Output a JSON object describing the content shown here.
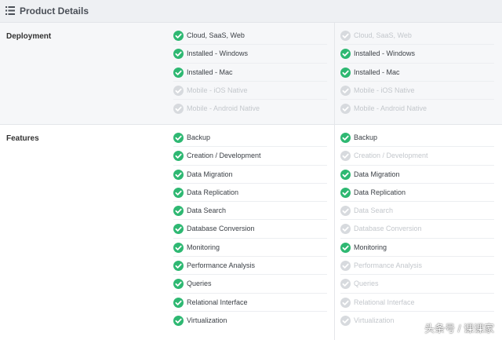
{
  "header": {
    "title": "Product Details"
  },
  "colors": {
    "check_on": "#2eb872",
    "check_off": "#d7dade",
    "header_bg": "#eef0f3",
    "deployment_bg": "#f6f7f9"
  },
  "sections": [
    {
      "key": "deployment",
      "label": "Deployment",
      "columns": [
        [
          {
            "label": "Cloud, SaaS, Web",
            "on": true
          },
          {
            "label": "Installed - Windows",
            "on": true
          },
          {
            "label": "Installed - Mac",
            "on": true
          },
          {
            "label": "Mobile - iOS Native",
            "on": false
          },
          {
            "label": "Mobile - Android Native",
            "on": false
          }
        ],
        [
          {
            "label": "Cloud, SaaS, Web",
            "on": false
          },
          {
            "label": "Installed - Windows",
            "on": true
          },
          {
            "label": "Installed - Mac",
            "on": true
          },
          {
            "label": "Mobile - iOS Native",
            "on": false
          },
          {
            "label": "Mobile - Android Native",
            "on": false
          }
        ]
      ]
    },
    {
      "key": "features",
      "label": "Features",
      "columns": [
        [
          {
            "label": "Backup",
            "on": true
          },
          {
            "label": "Creation / Development",
            "on": true
          },
          {
            "label": "Data Migration",
            "on": true
          },
          {
            "label": "Data Replication",
            "on": true
          },
          {
            "label": "Data Search",
            "on": true
          },
          {
            "label": "Database Conversion",
            "on": true
          },
          {
            "label": "Monitoring",
            "on": true
          },
          {
            "label": "Performance Analysis",
            "on": true
          },
          {
            "label": "Queries",
            "on": true
          },
          {
            "label": "Relational Interface",
            "on": true
          },
          {
            "label": "Virtualization",
            "on": true
          }
        ],
        [
          {
            "label": "Backup",
            "on": true
          },
          {
            "label": "Creation / Development",
            "on": false
          },
          {
            "label": "Data Migration",
            "on": true
          },
          {
            "label": "Data Replication",
            "on": true
          },
          {
            "label": "Data Search",
            "on": false
          },
          {
            "label": "Database Conversion",
            "on": false
          },
          {
            "label": "Monitoring",
            "on": true
          },
          {
            "label": "Performance Analysis",
            "on": false
          },
          {
            "label": "Queries",
            "on": false
          },
          {
            "label": "Relational Interface",
            "on": false
          },
          {
            "label": "Virtualization",
            "on": false
          }
        ]
      ]
    }
  ],
  "watermark": {
    "text": "头条号 / 课课家"
  }
}
